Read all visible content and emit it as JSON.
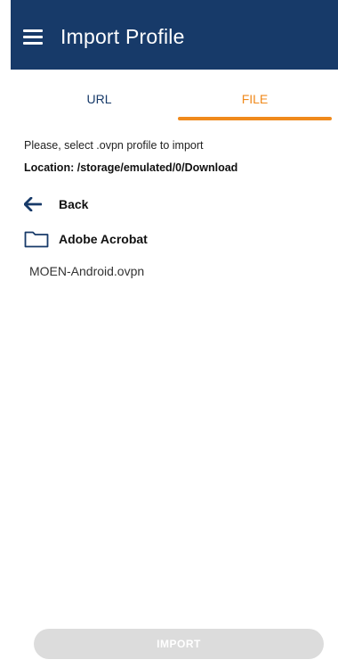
{
  "app_bar": {
    "title": "Import Profile",
    "menu_icon": "hamburger-menu-icon",
    "color": "#173a69"
  },
  "tabs": [
    {
      "label": "URL",
      "active": false
    },
    {
      "label": "FILE",
      "active": true
    }
  ],
  "tab_colors": {
    "active": "#f08a1c",
    "inactive": "#173a69"
  },
  "content": {
    "instruction": "Please, select .ovpn profile to import",
    "location": "Location: /storage/emulated/0/Download",
    "back": {
      "label": "Back",
      "icon": "arrow-left-icon"
    },
    "folders": [
      {
        "label": "Adobe Acrobat",
        "icon": "folder-icon"
      }
    ],
    "files": [
      {
        "label": "MOEN-Android.ovpn"
      }
    ]
  },
  "import_button": {
    "label": "IMPORT",
    "enabled": false
  }
}
